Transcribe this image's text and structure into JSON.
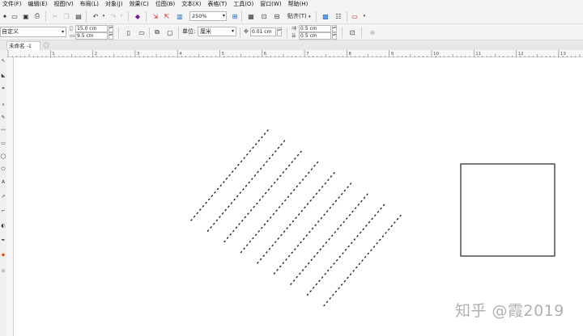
{
  "menu": [
    "文件(F)",
    "编辑(E)",
    "视图(V)",
    "布局(L)",
    "对象(J)",
    "效果(C)",
    "位图(B)",
    "文本(X)",
    "表格(T)",
    "工具(O)",
    "窗口(W)",
    "帮助(H)"
  ],
  "toolbar": {
    "zoom_value": "250%",
    "snap_label": "贴齐(T)",
    "icons": [
      "new-icon",
      "open-icon",
      "save-icon",
      "print-icon",
      "cut-icon",
      "copy-icon",
      "paste-icon",
      "undo-icon",
      "redo-icon",
      "search-content-icon",
      "import-icon",
      "export-icon",
      "publish-icon",
      "full-screen-icon",
      "rulers-icon",
      "grid-icon",
      "guidelines-icon",
      "welcome-screen-icon",
      "options-icon",
      "launch-icon"
    ]
  },
  "propbar": {
    "preset": "自定义",
    "page_width": "15.0 cm",
    "page_height": "9.5 cm",
    "units_label": "单位:",
    "units_value": "厘米",
    "nudge": "0.01 cm",
    "dup_x": "0.5 cm",
    "dup_y": "0.5 cm"
  },
  "tab": {
    "label": "未命名 -1"
  },
  "ruler": {
    "numbers": [
      "1",
      "2",
      "3",
      "4",
      "5",
      "6",
      "7",
      "8",
      "9",
      "10",
      "11",
      "12",
      "13",
      "14"
    ]
  },
  "canvas": {
    "dotted_line_count": 9,
    "watermark": "知乎 @霞2019"
  }
}
